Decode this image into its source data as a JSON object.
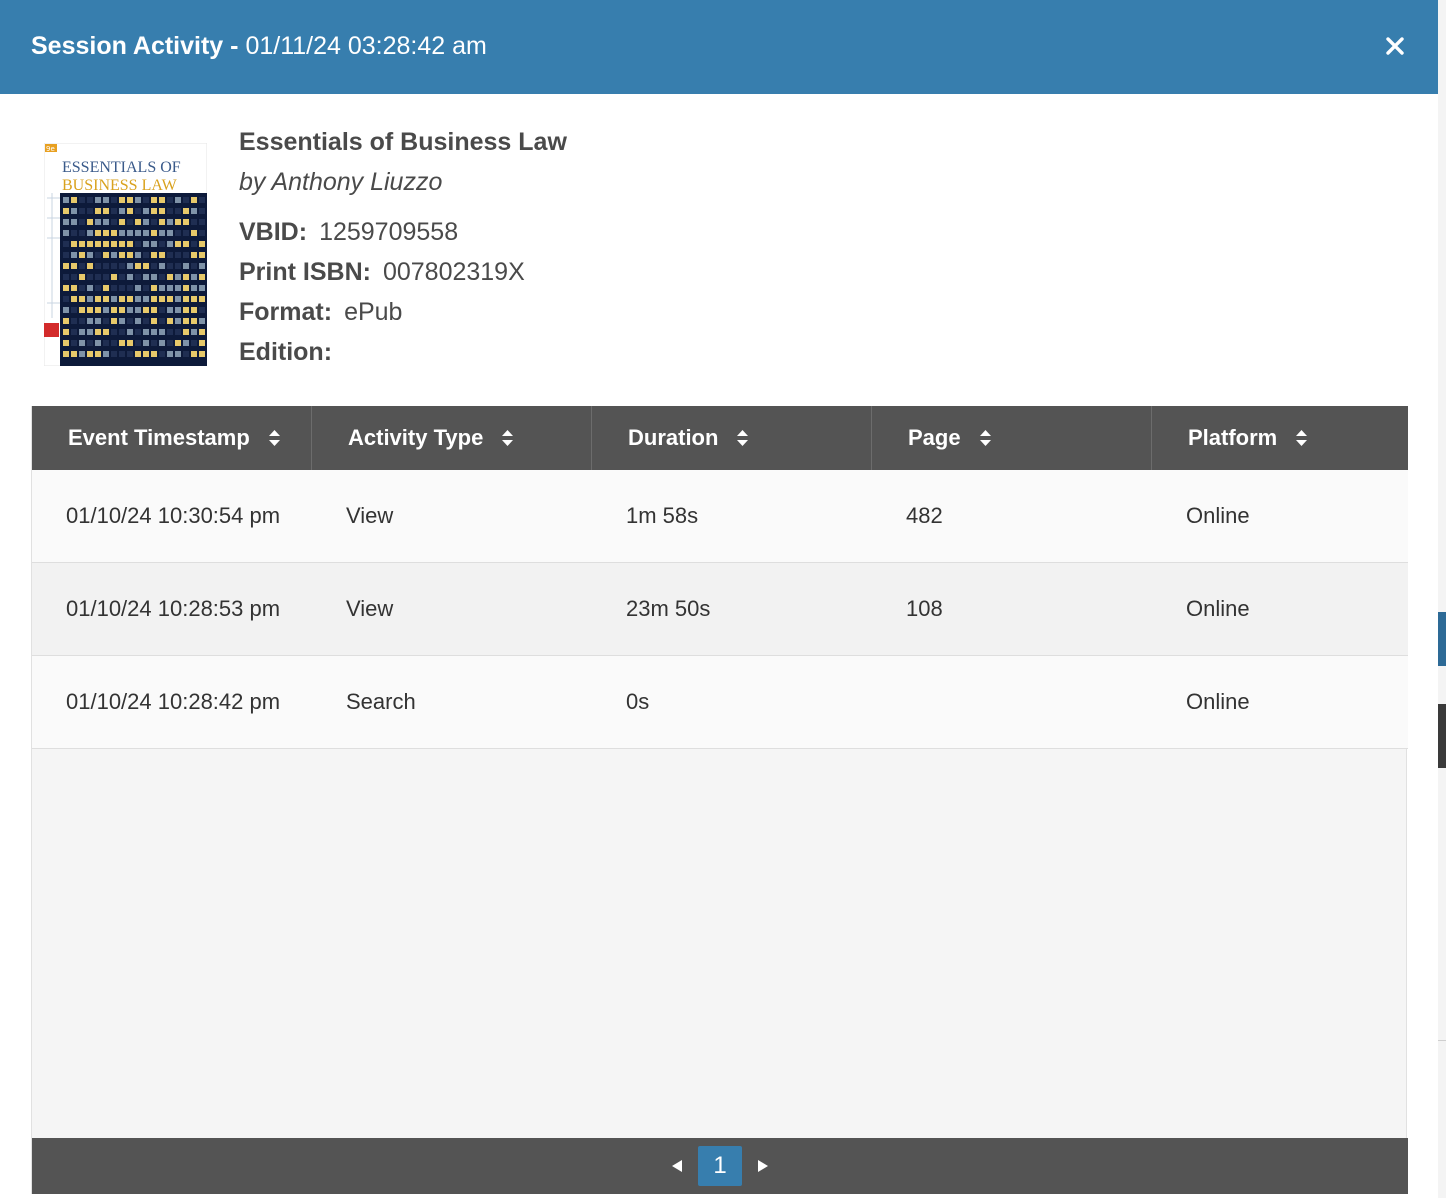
{
  "header": {
    "title": "Session Activity",
    "separator": "-",
    "timestamp": "01/11/24 03:28:42 am",
    "close_icon": "close-icon"
  },
  "book": {
    "cover": {
      "edition_badge": "9e",
      "title_line1": "ESSENTIALS OF",
      "title_line2": "BUSINESS LAW"
    },
    "title": "Essentials of Business Law",
    "author": "by Anthony Liuzzo",
    "meta": [
      {
        "label": "VBID:",
        "value": "1259709558"
      },
      {
        "label": "Print ISBN:",
        "value": "007802319X"
      },
      {
        "label": "Format:",
        "value": "ePub"
      },
      {
        "label": "Edition:",
        "value": ""
      }
    ]
  },
  "table": {
    "columns": [
      "Event Timestamp",
      "Activity Type",
      "Duration",
      "Page",
      "Platform"
    ],
    "rows": [
      [
        "01/10/24 10:30:54 pm",
        "View",
        "1m 58s",
        "482",
        "Online"
      ],
      [
        "01/10/24 10:28:53 pm",
        "View",
        "23m 50s",
        "108",
        "Online"
      ],
      [
        "01/10/24 10:28:42 pm",
        "Search",
        "0s",
        "",
        "Online"
      ]
    ]
  },
  "pagination": {
    "current_page": "1"
  },
  "colors": {
    "header_bg": "#377eae",
    "table_header_bg": "#545454",
    "active_page": "#377eae"
  }
}
